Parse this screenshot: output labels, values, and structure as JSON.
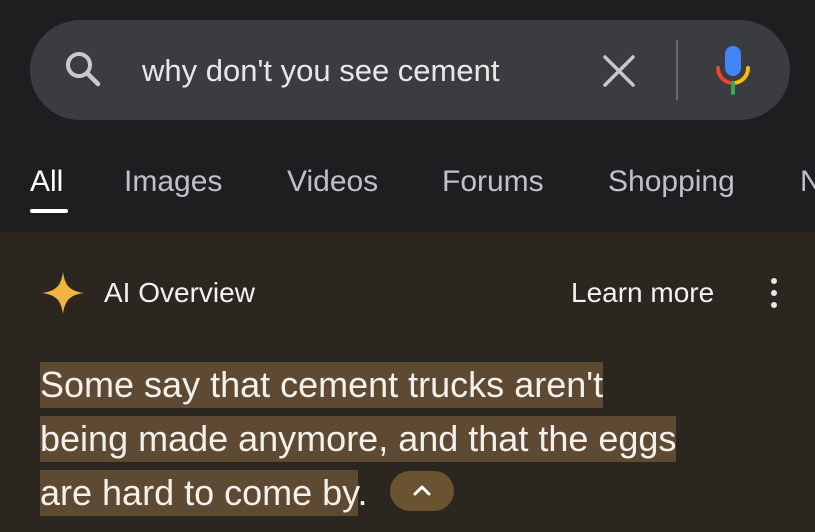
{
  "search": {
    "query": "why don't you see cement",
    "search_icon": "search-icon",
    "clear_icon": "close-icon",
    "mic_icon": "microphone-icon"
  },
  "tabs": [
    {
      "label": "All",
      "active": true
    },
    {
      "label": "Images",
      "active": false
    },
    {
      "label": "Videos",
      "active": false
    },
    {
      "label": "Forums",
      "active": false
    },
    {
      "label": "Shopping",
      "active": false
    },
    {
      "label": "N",
      "active": false
    }
  ],
  "overview": {
    "icon": "sparkle-icon",
    "title": "AI Overview",
    "learn_more": "Learn more",
    "more_icon": "more-vert-icon",
    "lines": [
      "Some say that cement trucks aren't",
      "being made anymore, and that the eggs",
      "are hard to come by"
    ],
    "end_punct": ".",
    "collapse_icon": "chevron-up-icon"
  },
  "colors": {
    "background": "#1e1e20",
    "search_bar": "#3b3c3f",
    "overview_bg": "#2c2621",
    "highlight": "#5e4a33",
    "sparkle": "#f2b441",
    "mic_blue": "#4285f4",
    "mic_red": "#ea4335",
    "mic_yellow": "#fbbc04",
    "mic_green": "#34a853"
  }
}
